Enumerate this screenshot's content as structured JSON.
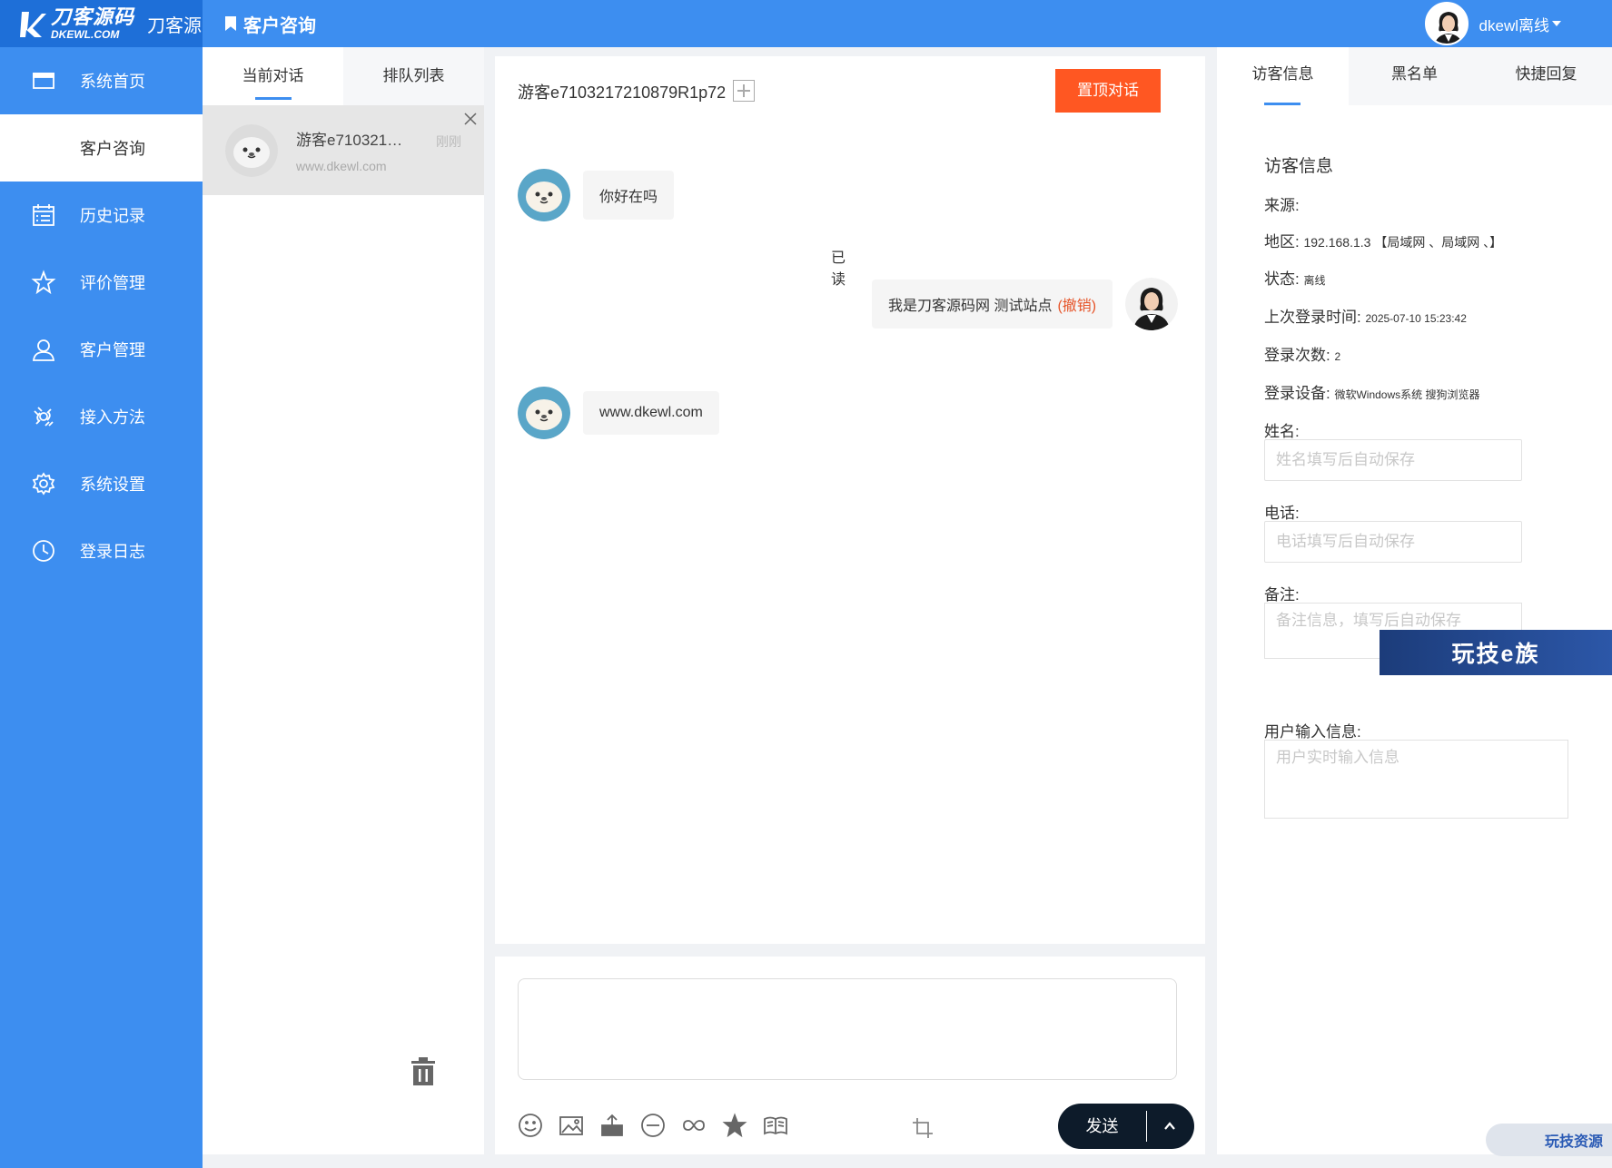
{
  "logo": {
    "cn": "刀客源码",
    "en": "DKEWL.COM",
    "brand": "刀客源"
  },
  "header": {
    "title": "客户咨询",
    "username": "dkewl离线"
  },
  "sidebar": {
    "items": [
      {
        "label": "系统首页",
        "icon": "window-icon"
      },
      {
        "label": "客户咨询",
        "icon": "chat-icon"
      },
      {
        "label": "历史记录",
        "icon": "calendar-list-icon"
      },
      {
        "label": "评价管理",
        "icon": "star-icon"
      },
      {
        "label": "客户管理",
        "icon": "user-icon"
      },
      {
        "label": "接入方法",
        "icon": "plug-icon"
      },
      {
        "label": "系统设置",
        "icon": "gear-icon"
      },
      {
        "label": "登录日志",
        "icon": "clock-icon"
      }
    ]
  },
  "conversations": {
    "tabs": [
      {
        "label": "当前对话"
      },
      {
        "label": "排队列表"
      }
    ],
    "items": [
      {
        "name": "游客e710321…",
        "site": "www.dkewl.com",
        "time": "刚刚"
      }
    ]
  },
  "chat": {
    "title": "游客e7103217210879R1p72",
    "pin_label": "置顶对话",
    "messages": [
      {
        "from": "visitor",
        "text": "你好在吗"
      },
      {
        "from": "agent",
        "text": "我是刀客源码网 测试站点",
        "revoke": "(撤销)",
        "read": "已读"
      },
      {
        "from": "visitor",
        "text": "www.dkewl.com"
      }
    ],
    "send_label": "发送",
    "input_value": ""
  },
  "right": {
    "tabs": [
      {
        "label": "访客信息"
      },
      {
        "label": "黑名单"
      },
      {
        "label": "快捷回复"
      }
    ],
    "section_title": "访客信息",
    "source_label": "来源:",
    "region_label": "地区:",
    "region_value": "192.168.1.3 【局域网 、局域网 、】",
    "status_label": "状态:",
    "status_value": "离线",
    "last_login_label": "上次登录时间:",
    "last_login_value": "2025-07-10 15:23:42",
    "login_count_label": "登录次数:",
    "login_count_value": "2",
    "device_label": "登录设备:",
    "device_value": "微软Windows系统 搜狗浏览器",
    "name_label": "姓名:",
    "name_placeholder": "姓名填写后自动保存",
    "phone_label": "电话:",
    "phone_placeholder": "电话填写后自动保存",
    "note_label": "备注:",
    "note_placeholder": "备注信息，填写后自动保存",
    "user_input_label": "用户输入信息:",
    "user_input_placeholder": "用户实时输入信息"
  },
  "watermarks": {
    "main": "玩技e族",
    "corner": "玩技资源"
  },
  "colors": {
    "primary": "#3d8ef0",
    "pin": "#ff5722",
    "send": "#0d1b2a",
    "revoke": "#e6552a"
  }
}
